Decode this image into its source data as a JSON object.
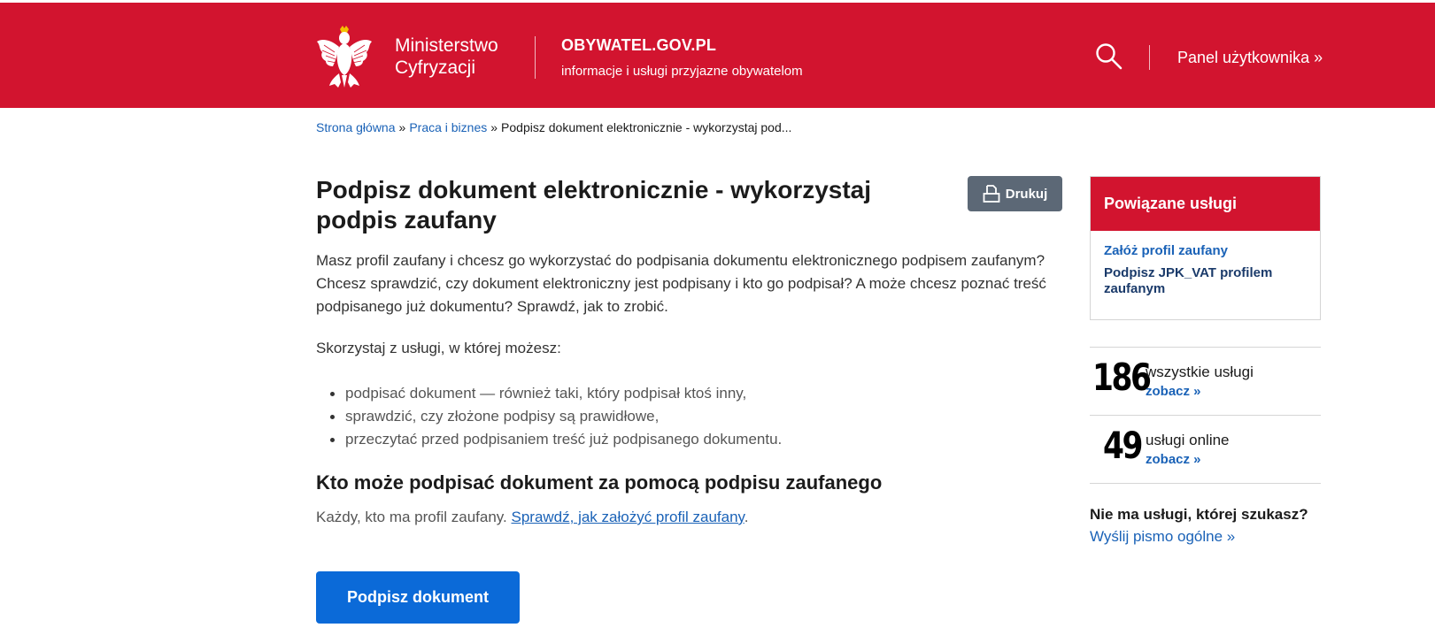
{
  "header": {
    "ministry_line1": "Ministerstwo",
    "ministry_line2": "Cyfryzacji",
    "site_name": "OBYWATEL.GOV.PL",
    "site_tagline": "informacje i usługi przyjazne obywatelom",
    "user_panel_link": "Panel użytkownika »",
    "icons": [
      "polish-eagle-emblem",
      "search-icon"
    ],
    "colors": {
      "brand_red": "#d2142f",
      "link_blue": "#1a62b7",
      "cta_blue": "#0b6ad8",
      "print_gray": "#5c6876"
    }
  },
  "breadcrumb": {
    "items": [
      "Strona główna",
      "Praca i biznes"
    ],
    "separator": "»",
    "current": "Podpisz dokument elektronicznie - wykorzystaj pod..."
  },
  "main": {
    "title": "Podpisz dokument elektronicznie - wykorzystaj podpis zaufany",
    "print_label": "Drukuj",
    "lead": "Masz profil zaufany i chcesz go wykorzystać do podpisania dokumentu elektronicznego podpisem zaufanym? Chcesz sprawdzić, czy dokument elektroniczny jest podpisany i kto go podpisał? A może chcesz poznać treść podpisanego już dokumentu? Sprawdź, jak to zrobić.",
    "intro": "Skorzystaj z usługi, w której możesz:",
    "bullets": [
      "podpisać dokument — również taki, który podpisał ktoś inny,",
      "sprawdzić, czy złożone podpisy są prawidłowe,",
      "przeczytać przed podpisaniem treść już podpisanego dokumentu."
    ],
    "who_heading": "Kto może podpisać dokument za pomocą podpisu zaufanego",
    "who_text": "Każdy, kto ma profil zaufany.",
    "who_link": "Sprawdź, jak założyć profil zaufany",
    "who_end": ".",
    "cta_label": "Podpisz dokument"
  },
  "sidebar": {
    "related_title": "Powiązane usługi",
    "related_links": [
      "Załóż profil zaufany",
      "Podpisz JPK_VAT profilem zaufanym"
    ],
    "stats": [
      {
        "number": "186",
        "label": "wszystkie usługi",
        "link": "zobacz »"
      },
      {
        "number": "49",
        "label": "usługi online",
        "link": "zobacz »"
      }
    ],
    "missing_question": "Nie ma usługi, której szukasz?",
    "missing_link": "Wyślij pismo ogólne »"
  }
}
